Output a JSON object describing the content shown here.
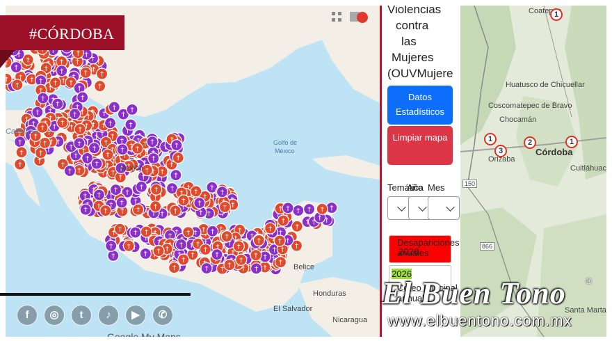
{
  "tag": {
    "text": "#CÓRDOBA"
  },
  "sidebar": {
    "title_lines": [
      "Violencias",
      "contra",
      "las",
      "Mujeres",
      "(OUVMujere"
    ],
    "buttons": {
      "stats": "Datos Estadísticos",
      "clear": "Limpiar mapa"
    },
    "filters": {
      "tematica": "Temática",
      "anio": "Año",
      "mes": "Mes"
    },
    "legend": [
      {
        "label": "Desapariciones anuales",
        "year": "2026",
        "color": "#ff0000"
      },
      {
        "label": "Coteo principal annual",
        "year": "2026",
        "color": "#ffffff"
      }
    ]
  },
  "map_left": {
    "labels": [
      "Golfo de México",
      "México",
      "Belice",
      "Honduras",
      "El Salvador",
      "Nicaragua",
      "Guatemala",
      "California"
    ],
    "attribution": "Google My Maps"
  },
  "map_right": {
    "places": [
      "Coatepec",
      "Huatusco de Chicuellar",
      "Coscomatepec de Bravo",
      "Chocamán",
      "Orizaba",
      "Córdoba",
      "Cuitláhuac",
      "Santa Marta",
      "866",
      "150"
    ],
    "markers": [
      "1",
      "1",
      "3",
      "2",
      "1"
    ]
  },
  "social": {
    "icons": [
      "facebook-icon",
      "instagram-icon",
      "twitter-icon",
      "tiktok-icon",
      "youtube-icon",
      "whatsapp-icon"
    ],
    "glyphs": [
      "f",
      "◎",
      "t",
      "♪",
      "▶",
      "✆"
    ]
  },
  "watermark": {
    "brand": "El Buen Tono",
    "reg": "®",
    "url": "www.elbuentono.com.mx"
  }
}
